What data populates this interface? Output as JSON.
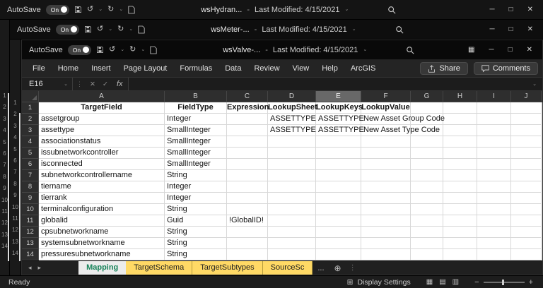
{
  "colors": {
    "sheet_tab_yellow": "#ffd965",
    "active_sheet_text": "#17835a",
    "selected_column_header": "#686868",
    "titlebar": "#0b0b0b",
    "ribbon": "#242424"
  },
  "windows": {
    "back1": {
      "autosave_label": "AutoSave",
      "autosave_state": "On",
      "title": "wsHydran...",
      "separator": "-",
      "modified": "Last Modified: 4/15/2021"
    },
    "back2": {
      "autosave_label": "AutoSave",
      "autosave_state": "On",
      "title": "wsMeter-...",
      "separator": "-",
      "modified": "Last Modified: 4/15/2021"
    },
    "front": {
      "autosave_label": "AutoSave",
      "autosave_state": "On",
      "title": "wsValve-...",
      "separator": "-",
      "modified": "Last Modified: 4/15/2021"
    }
  },
  "ribbon": {
    "tabs": [
      "File",
      "Home",
      "Insert",
      "Page Layout",
      "Formulas",
      "Data",
      "Review",
      "View",
      "Help",
      "ArcGIS"
    ],
    "share_label": "Share",
    "comments_label": "Comments"
  },
  "formula_bar": {
    "name_box": "E16",
    "fx_label": "fx"
  },
  "grid": {
    "columns": [
      "A",
      "B",
      "C",
      "D",
      "E",
      "F",
      "G",
      "H",
      "I",
      "J"
    ],
    "selected_column": "E",
    "rows": [
      {
        "n": "1",
        "header": true,
        "cells": [
          "TargetField",
          "FieldType",
          "Expression",
          "LookupSheet",
          "LookupKeys",
          "LookupValue"
        ]
      },
      {
        "n": "2",
        "cells": [
          "assetgroup",
          "Integer",
          "",
          "ASSETTYPE",
          "ASSETTYPE",
          "New Asset Group Code"
        ]
      },
      {
        "n": "3",
        "cells": [
          "assettype",
          "SmallInteger",
          "",
          "ASSETTYPE",
          "ASSETTYPE",
          "New Asset Type Code"
        ]
      },
      {
        "n": "4",
        "cells": [
          "associationstatus",
          "SmallInteger"
        ]
      },
      {
        "n": "5",
        "cells": [
          "issubnetworkcontroller",
          "SmallInteger"
        ]
      },
      {
        "n": "6",
        "cells": [
          "isconnected",
          "SmallInteger"
        ]
      },
      {
        "n": "7",
        "cells": [
          "subnetworkcontrollername",
          "String"
        ]
      },
      {
        "n": "8",
        "cells": [
          "tiername",
          "Integer"
        ]
      },
      {
        "n": "9",
        "cells": [
          "tierrank",
          "Integer"
        ]
      },
      {
        "n": "10",
        "cells": [
          "terminalconfiguration",
          "String"
        ]
      },
      {
        "n": "11",
        "cells": [
          "globalid",
          "Guid",
          "!GlobalID!"
        ]
      },
      {
        "n": "12",
        "cells": [
          "cpsubnetworkname",
          "String"
        ]
      },
      {
        "n": "13",
        "cells": [
          "systemsubnetworkname",
          "String"
        ]
      },
      {
        "n": "14",
        "cells": [
          "pressuresubnetworkname",
          "String"
        ]
      }
    ]
  },
  "sheets": {
    "tabs": [
      {
        "label": "Mapping",
        "style": "active"
      },
      {
        "label": "TargetSchema",
        "style": "yellow"
      },
      {
        "label": "TargetSubtypes",
        "style": "yellow"
      },
      {
        "label": "SourceSc",
        "style": "yellow"
      }
    ],
    "overflow": "..."
  },
  "status_bar": {
    "ready": "Ready",
    "display_settings": "Display Settings"
  },
  "strips": {
    "row_numbers": [
      "1",
      "2",
      "3",
      "4",
      "5",
      "6",
      "7",
      "8",
      "9",
      "10",
      "11",
      "12",
      "13",
      "14"
    ]
  }
}
